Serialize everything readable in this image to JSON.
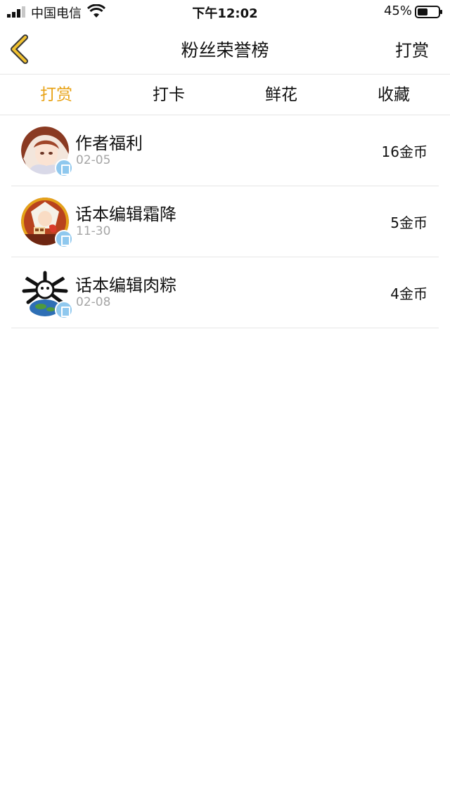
{
  "status_bar": {
    "carrier": "中国电信",
    "time": "下午12:02",
    "battery": "45%"
  },
  "nav": {
    "back_icon": "chevron-left-icon",
    "title": "粉丝荣誉榜",
    "action": "打赏"
  },
  "tabs": [
    {
      "label": "打赏",
      "active": true
    },
    {
      "label": "打卡",
      "active": false
    },
    {
      "label": "鲜花",
      "active": false
    },
    {
      "label": "收藏",
      "active": false
    }
  ],
  "colors": {
    "accent": "#e8a317",
    "badge": "#8fc8ee",
    "divider": "#e6e6e6",
    "date_text": "#a5a5a5"
  },
  "list": [
    {
      "name": "作者福利",
      "date": "02-05",
      "amount": "16金币"
    },
    {
      "name": "话本编辑霜降",
      "date": "11-30",
      "amount": "5金币"
    },
    {
      "name": "话本编辑肉粽",
      "date": "02-08",
      "amount": "4金币"
    }
  ]
}
